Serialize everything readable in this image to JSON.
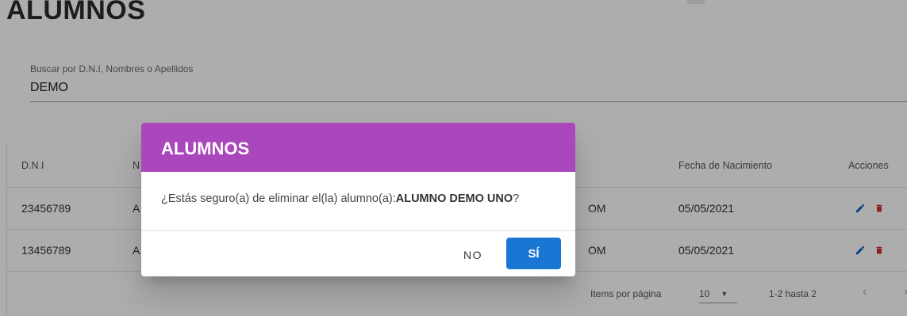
{
  "page": {
    "title": "ALUMNOS"
  },
  "search": {
    "label": "Buscar por D.N.I, Nombres o Apellidos",
    "value": "DEMO"
  },
  "table": {
    "headers": {
      "dni": "D.N.I",
      "nombres_partial": "N",
      "fecha": "Fecha de Nacimiento",
      "acciones": "Acciones"
    },
    "rows": [
      {
        "dni": "23456789",
        "nombre_partial": "A",
        "email_partial": "OM",
        "fecha": "05/05/2021"
      },
      {
        "dni": "13456789",
        "nombre_partial": "A",
        "email_partial": "OM",
        "fecha": "05/05/2021"
      }
    ]
  },
  "paginator": {
    "items_label": "Items por página",
    "page_size": "10",
    "range": "1-2 hasta 2"
  },
  "dialog": {
    "title": "ALUMNOS",
    "message_prefix": "¿Estás seguro(a) de eliminar el(la) alumno(a):",
    "message_name": "ALUMNO DEMO UNO",
    "message_suffix": "?",
    "no_label": "NO",
    "yes_label": "SÍ"
  },
  "colors": {
    "dialog_header": "#ab47bc",
    "primary_button": "#1976d2",
    "edit_icon": "#1565c0",
    "delete_icon": "#d32f2f"
  },
  "icons": {
    "edit": "pencil-icon",
    "delete": "trash-icon",
    "prev": "chevron-left-icon",
    "next": "chevron-right-icon",
    "dropdown": "caret-down-icon"
  }
}
